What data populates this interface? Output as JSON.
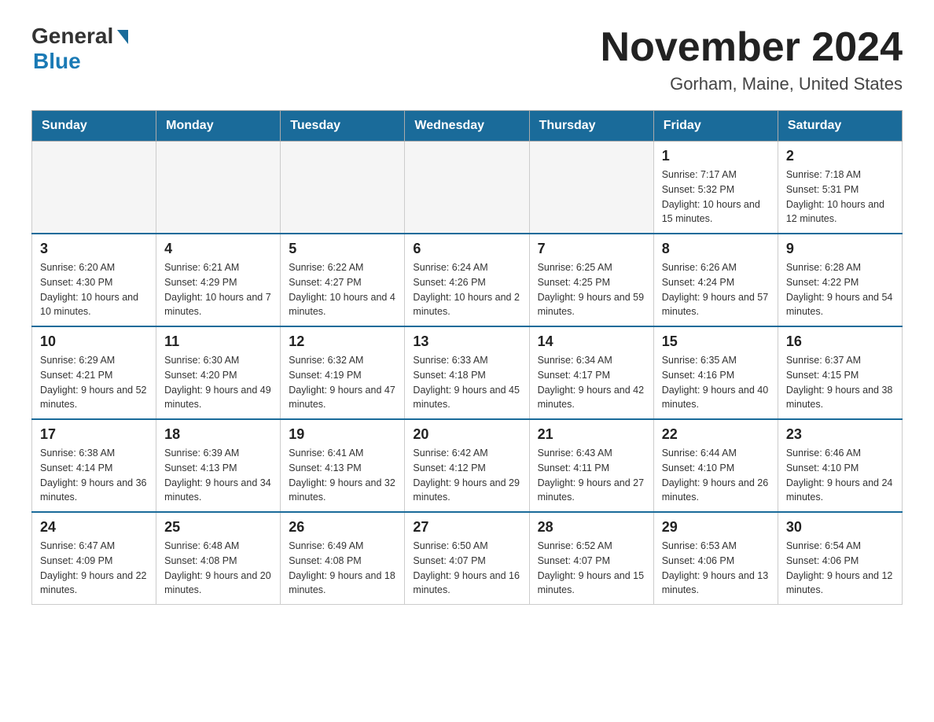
{
  "header": {
    "logo_general": "General",
    "logo_blue": "Blue",
    "title": "November 2024",
    "subtitle": "Gorham, Maine, United States"
  },
  "days_of_week": [
    "Sunday",
    "Monday",
    "Tuesday",
    "Wednesday",
    "Thursday",
    "Friday",
    "Saturday"
  ],
  "weeks": [
    [
      {
        "day": "",
        "empty": true
      },
      {
        "day": "",
        "empty": true
      },
      {
        "day": "",
        "empty": true
      },
      {
        "day": "",
        "empty": true
      },
      {
        "day": "",
        "empty": true
      },
      {
        "day": "1",
        "sunrise": "Sunrise: 7:17 AM",
        "sunset": "Sunset: 5:32 PM",
        "daylight": "Daylight: 10 hours and 15 minutes."
      },
      {
        "day": "2",
        "sunrise": "Sunrise: 7:18 AM",
        "sunset": "Sunset: 5:31 PM",
        "daylight": "Daylight: 10 hours and 12 minutes."
      }
    ],
    [
      {
        "day": "3",
        "sunrise": "Sunrise: 6:20 AM",
        "sunset": "Sunset: 4:30 PM",
        "daylight": "Daylight: 10 hours and 10 minutes."
      },
      {
        "day": "4",
        "sunrise": "Sunrise: 6:21 AM",
        "sunset": "Sunset: 4:29 PM",
        "daylight": "Daylight: 10 hours and 7 minutes."
      },
      {
        "day": "5",
        "sunrise": "Sunrise: 6:22 AM",
        "sunset": "Sunset: 4:27 PM",
        "daylight": "Daylight: 10 hours and 4 minutes."
      },
      {
        "day": "6",
        "sunrise": "Sunrise: 6:24 AM",
        "sunset": "Sunset: 4:26 PM",
        "daylight": "Daylight: 10 hours and 2 minutes."
      },
      {
        "day": "7",
        "sunrise": "Sunrise: 6:25 AM",
        "sunset": "Sunset: 4:25 PM",
        "daylight": "Daylight: 9 hours and 59 minutes."
      },
      {
        "day": "8",
        "sunrise": "Sunrise: 6:26 AM",
        "sunset": "Sunset: 4:24 PM",
        "daylight": "Daylight: 9 hours and 57 minutes."
      },
      {
        "day": "9",
        "sunrise": "Sunrise: 6:28 AM",
        "sunset": "Sunset: 4:22 PM",
        "daylight": "Daylight: 9 hours and 54 minutes."
      }
    ],
    [
      {
        "day": "10",
        "sunrise": "Sunrise: 6:29 AM",
        "sunset": "Sunset: 4:21 PM",
        "daylight": "Daylight: 9 hours and 52 minutes."
      },
      {
        "day": "11",
        "sunrise": "Sunrise: 6:30 AM",
        "sunset": "Sunset: 4:20 PM",
        "daylight": "Daylight: 9 hours and 49 minutes."
      },
      {
        "day": "12",
        "sunrise": "Sunrise: 6:32 AM",
        "sunset": "Sunset: 4:19 PM",
        "daylight": "Daylight: 9 hours and 47 minutes."
      },
      {
        "day": "13",
        "sunrise": "Sunrise: 6:33 AM",
        "sunset": "Sunset: 4:18 PM",
        "daylight": "Daylight: 9 hours and 45 minutes."
      },
      {
        "day": "14",
        "sunrise": "Sunrise: 6:34 AM",
        "sunset": "Sunset: 4:17 PM",
        "daylight": "Daylight: 9 hours and 42 minutes."
      },
      {
        "day": "15",
        "sunrise": "Sunrise: 6:35 AM",
        "sunset": "Sunset: 4:16 PM",
        "daylight": "Daylight: 9 hours and 40 minutes."
      },
      {
        "day": "16",
        "sunrise": "Sunrise: 6:37 AM",
        "sunset": "Sunset: 4:15 PM",
        "daylight": "Daylight: 9 hours and 38 minutes."
      }
    ],
    [
      {
        "day": "17",
        "sunrise": "Sunrise: 6:38 AM",
        "sunset": "Sunset: 4:14 PM",
        "daylight": "Daylight: 9 hours and 36 minutes."
      },
      {
        "day": "18",
        "sunrise": "Sunrise: 6:39 AM",
        "sunset": "Sunset: 4:13 PM",
        "daylight": "Daylight: 9 hours and 34 minutes."
      },
      {
        "day": "19",
        "sunrise": "Sunrise: 6:41 AM",
        "sunset": "Sunset: 4:13 PM",
        "daylight": "Daylight: 9 hours and 32 minutes."
      },
      {
        "day": "20",
        "sunrise": "Sunrise: 6:42 AM",
        "sunset": "Sunset: 4:12 PM",
        "daylight": "Daylight: 9 hours and 29 minutes."
      },
      {
        "day": "21",
        "sunrise": "Sunrise: 6:43 AM",
        "sunset": "Sunset: 4:11 PM",
        "daylight": "Daylight: 9 hours and 27 minutes."
      },
      {
        "day": "22",
        "sunrise": "Sunrise: 6:44 AM",
        "sunset": "Sunset: 4:10 PM",
        "daylight": "Daylight: 9 hours and 26 minutes."
      },
      {
        "day": "23",
        "sunrise": "Sunrise: 6:46 AM",
        "sunset": "Sunset: 4:10 PM",
        "daylight": "Daylight: 9 hours and 24 minutes."
      }
    ],
    [
      {
        "day": "24",
        "sunrise": "Sunrise: 6:47 AM",
        "sunset": "Sunset: 4:09 PM",
        "daylight": "Daylight: 9 hours and 22 minutes."
      },
      {
        "day": "25",
        "sunrise": "Sunrise: 6:48 AM",
        "sunset": "Sunset: 4:08 PM",
        "daylight": "Daylight: 9 hours and 20 minutes."
      },
      {
        "day": "26",
        "sunrise": "Sunrise: 6:49 AM",
        "sunset": "Sunset: 4:08 PM",
        "daylight": "Daylight: 9 hours and 18 minutes."
      },
      {
        "day": "27",
        "sunrise": "Sunrise: 6:50 AM",
        "sunset": "Sunset: 4:07 PM",
        "daylight": "Daylight: 9 hours and 16 minutes."
      },
      {
        "day": "28",
        "sunrise": "Sunrise: 6:52 AM",
        "sunset": "Sunset: 4:07 PM",
        "daylight": "Daylight: 9 hours and 15 minutes."
      },
      {
        "day": "29",
        "sunrise": "Sunrise: 6:53 AM",
        "sunset": "Sunset: 4:06 PM",
        "daylight": "Daylight: 9 hours and 13 minutes."
      },
      {
        "day": "30",
        "sunrise": "Sunrise: 6:54 AM",
        "sunset": "Sunset: 4:06 PM",
        "daylight": "Daylight: 9 hours and 12 minutes."
      }
    ]
  ]
}
